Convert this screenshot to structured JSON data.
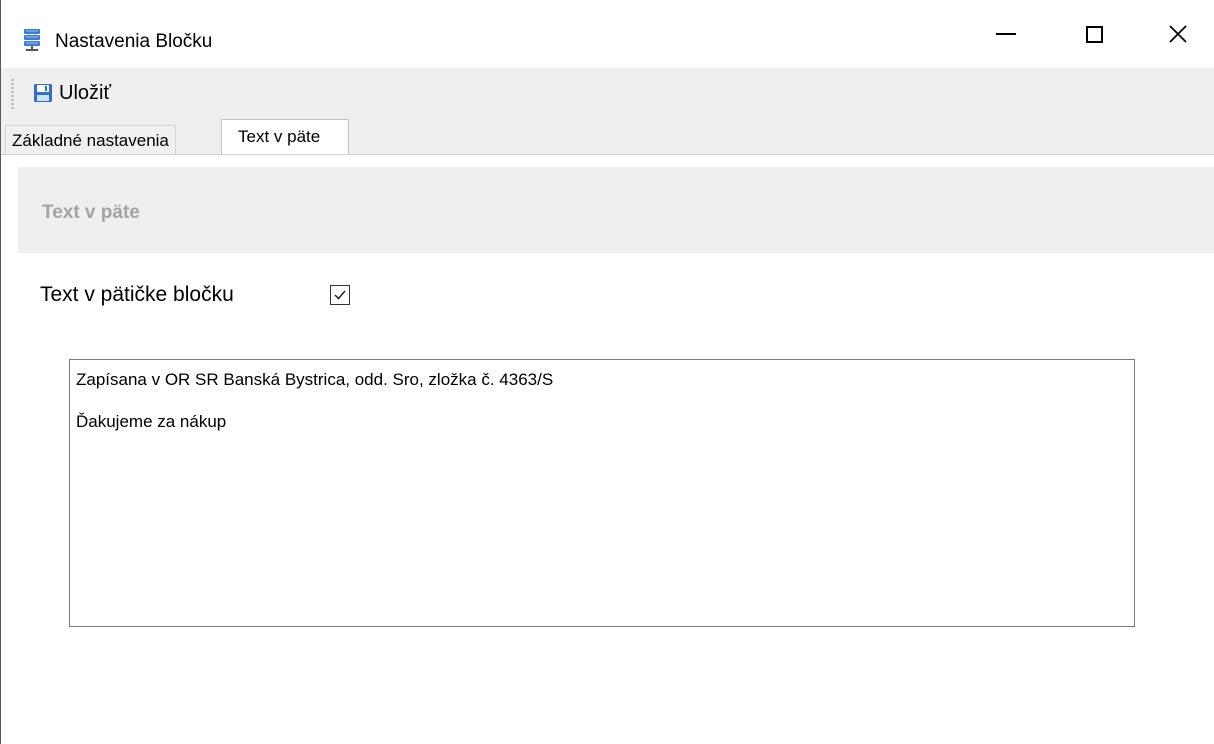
{
  "window": {
    "title": "Nastavenia Bločku",
    "icon": "database-icon",
    "controls": {
      "minimize": "minimize-icon",
      "maximize": "maximize-icon",
      "close": "close-icon"
    }
  },
  "toolbar": {
    "save_label": "Uložiť",
    "save_icon": "floppy-disk-icon"
  },
  "tabs": [
    {
      "label": "Základné nastavenia",
      "active": false
    },
    {
      "label": "Text v päte",
      "active": true
    }
  ],
  "section": {
    "title": "Text v päte"
  },
  "footer_text": {
    "label": "Text v pätičke bločku",
    "enabled": true,
    "lines": [
      "Zapísana v OR SR Banská Bystrica, odd. Sro, zložka č. 4363/S",
      "Ďakujeme za nákup"
    ]
  },
  "colors": {
    "toolbar_bg": "#efefef",
    "section_header_bg": "#efefef",
    "section_title": "#a4a4a4",
    "icon_blue": "#3a7bd5"
  }
}
